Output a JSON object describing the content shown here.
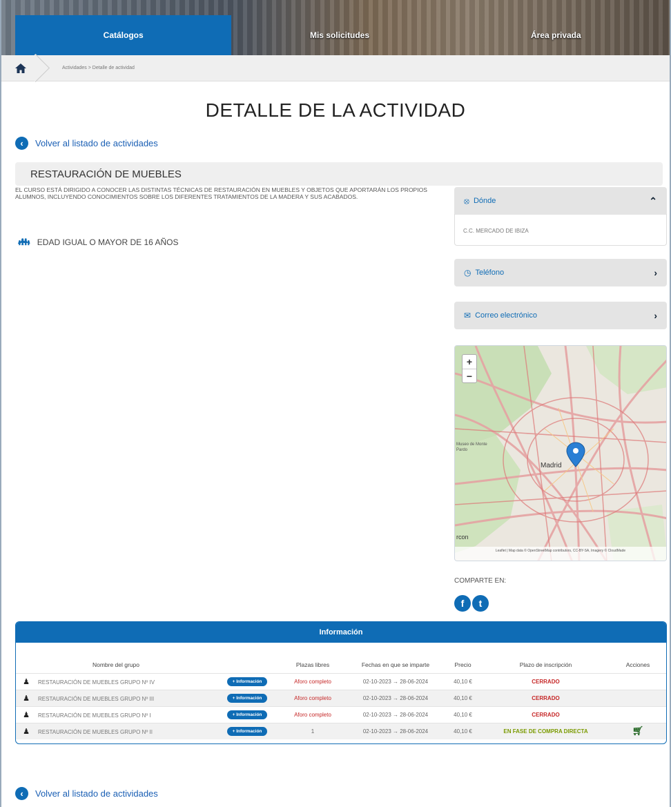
{
  "nav": {
    "tabs": [
      {
        "label": "Catálogos",
        "active": true
      },
      {
        "label": "Mis solicitudes",
        "active": false
      },
      {
        "label": "Área privada",
        "active": false
      }
    ]
  },
  "breadcrumb": {
    "text": "Actividades > Detalle de actividad"
  },
  "page_title": "DETALLE DE LA ACTIVIDAD",
  "back_link": "Volver al listado de actividades",
  "activity": {
    "title": "RESTAURACIÓN DE MUEBLES",
    "description": "EL CURSO ESTÁ DIRIGIDO A CONOCER LAS DISTINTAS TÉCNICAS DE RESTAURACIÓN EN MUEBLES Y OBJETOS QUE APORTARÁN LOS PROPIOS ALUMNOS, INCLUYENDO CONOCIMIENTOS SOBRE LOS DIFERENTES TRATAMIENTOS DE LA MADERA Y SUS ACABADOS.",
    "age": "EDAD IGUAL O MAYOR DE 16 AÑOS"
  },
  "sidebar": {
    "donde_label": "Dónde",
    "donde_value": "C.C. MERCADO DE IBIZA",
    "telefono_label": "Teléfono",
    "correo_label": "Correo electrónico",
    "map": {
      "city_label": "Madrid",
      "left_label": "Museo de Monte",
      "left_label2": "Pardo",
      "bottom_label": "rcon",
      "attribution": "Leaflet | Map data © OpenStreetMap contributors, CC-BY-SA, Imagery © CloudMade",
      "zoom_in": "+",
      "zoom_out": "−"
    },
    "share_label": "COMPARTE EN:",
    "facebook_glyph": "f",
    "twitter_glyph": "t"
  },
  "info": {
    "header": "Información",
    "columns": [
      "Nombre del grupo",
      "",
      "Plazas libres",
      "Fechas en que se imparte",
      "Precio",
      "Plazo de inscripción",
      "Acciones"
    ],
    "button_label": "+ Información",
    "rows": [
      {
        "name": "RESTAURACIÓN DE MUEBLES GRUPO Nº IV",
        "plazas": "Aforo completo",
        "fechas": "02-10-2023 → 28-06-2024",
        "precio": "40,10 €",
        "plazo": "CERRADO",
        "plazo_status": "closed"
      },
      {
        "name": "RESTAURACIÓN DE MUEBLES GRUPO Nº III",
        "plazas": "Aforo completo",
        "fechas": "02-10-2023 → 28-06-2024",
        "precio": "40,10 €",
        "plazo": "CERRADO",
        "plazo_status": "closed"
      },
      {
        "name": "RESTAURACIÓN DE MUEBLES GRUPO Nº I",
        "plazas": "Aforo completo",
        "fechas": "02-10-2023 → 28-06-2024",
        "precio": "40,10 €",
        "plazo": "CERRADO",
        "plazo_status": "closed"
      },
      {
        "name": "RESTAURACIÓN DE MUEBLES GRUPO Nº II",
        "plazas": "1",
        "fechas": "02-10-2023 → 28-06-2024",
        "precio": "40,10 €",
        "plazo": "EN FASE DE COMPRA DIRECTA",
        "plazo_status": "open",
        "action_icon": "cart-icon"
      }
    ]
  },
  "colors": {
    "primary": "#0f6cb5",
    "closed": "#c62828",
    "open": "#7a9a00"
  }
}
